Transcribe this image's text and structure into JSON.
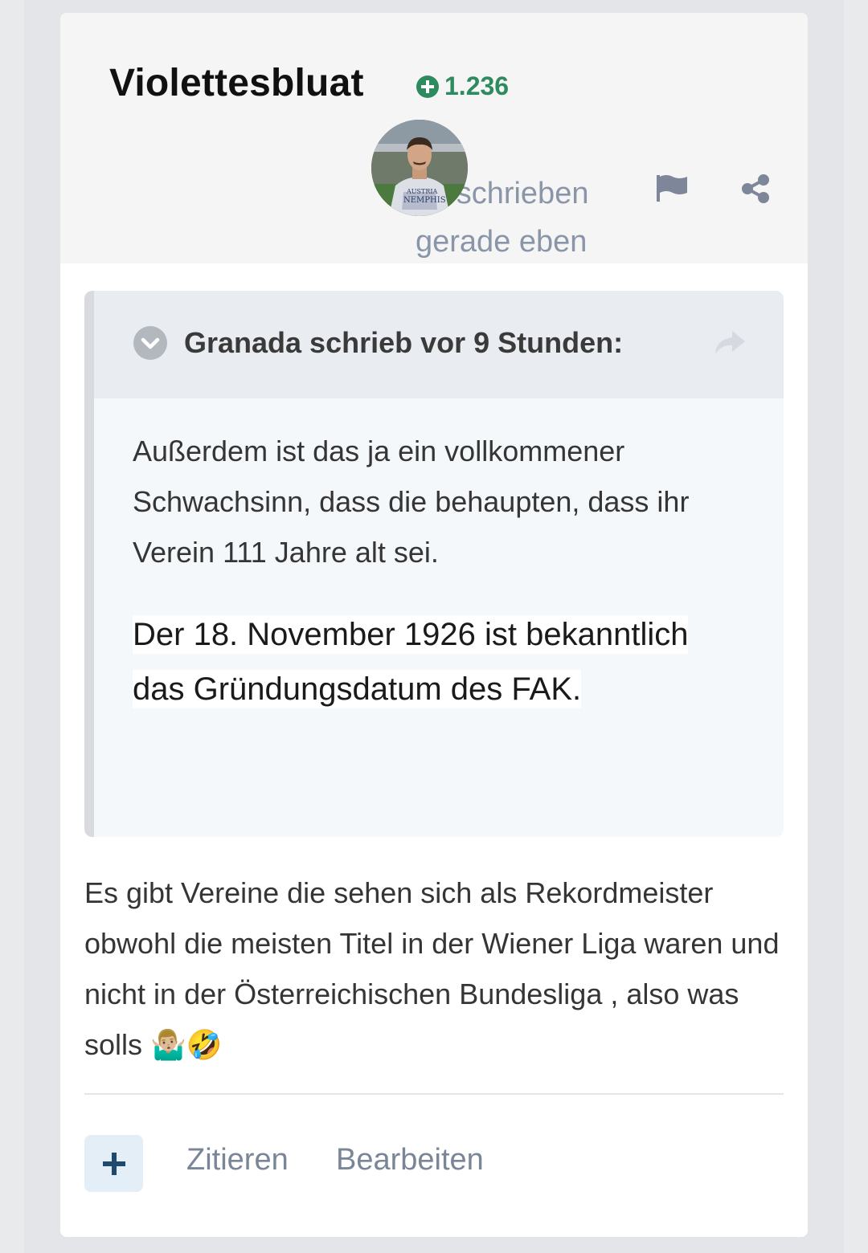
{
  "post": {
    "author": "Violettesbluat",
    "reputation": "1.236",
    "posted_label": "Geschrieben",
    "posted_time": "gerade eben"
  },
  "quote": {
    "citation": "Granada schrieb vor 9 Stunden:",
    "paragraph1": "Außerdem ist das ja ein vollkommener Schwachsinn, dass die behaupten, dass ihr Verein 111 Jahre alt sei.",
    "paragraph2_line1": "Der 18. November 1926 ist bekanntlich",
    "paragraph2_line2": "das Gründungsdatum des FAK."
  },
  "body": {
    "text": "Es gibt Vereine die sehen sich als Rekordmeister obwohl die meisten Titel in der Wiener Liga waren und nicht in der Österreichischen Bundesliga , also was solls 🤷🏼‍♂️🤣"
  },
  "actions": {
    "quote_label": "Zitieren",
    "edit_label": "Bearbeiten"
  },
  "icons": {
    "reputation": "plus-circle-icon",
    "report": "flag-icon",
    "share": "share-icon",
    "toggle": "chevron-down-icon",
    "goto": "reply-arrow-icon",
    "react": "plus-icon"
  },
  "colors": {
    "reputation": "#2e8a5f",
    "meta": "#8a95a8",
    "react_button_bg": "#e4eef7",
    "react_button_fg": "#1f4a6e"
  }
}
